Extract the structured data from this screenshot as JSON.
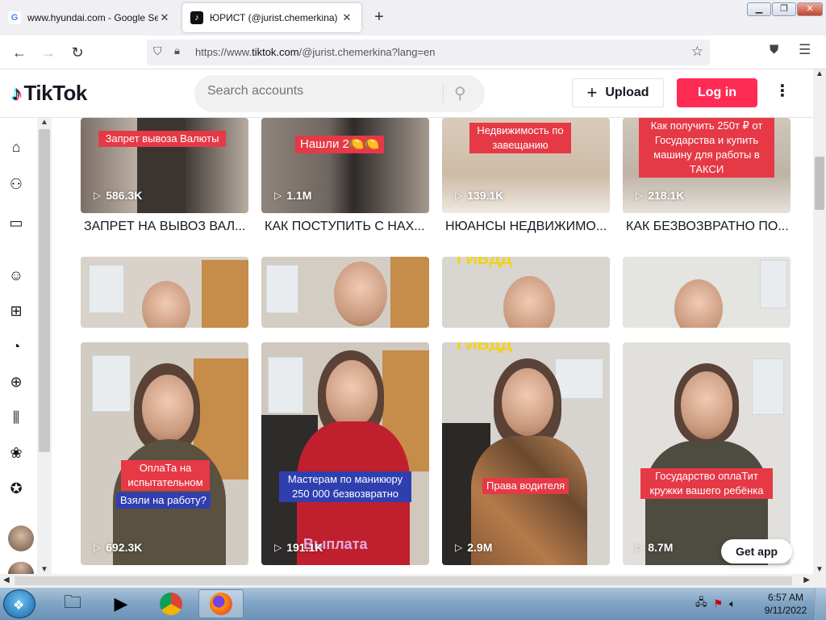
{
  "browser": {
    "tabs": [
      {
        "title": "www.hyundai.com - Google Sea",
        "favicon": "G"
      },
      {
        "title": "ЮРИСТ (@jurist.chemerkina) T",
        "favicon": "♪"
      }
    ],
    "new_tab": "+",
    "url_prefix": "https://www.",
    "url_domain": "tiktok.com",
    "url_suffix": "/@jurist.chemerkina?lang=en"
  },
  "tiktok": {
    "logo": "TikTok",
    "search_placeholder": "Search accounts",
    "upload_label": "Upload",
    "login_label": "Log in"
  },
  "videos": [
    {
      "views": "586.3K",
      "title": "ЗАПРЕТ НА ВЫВОЗ ВАЛ...",
      "caption": "Запрет вывоза Валюты"
    },
    {
      "views": "1.1M",
      "title": "КАК ПОСТУПИТЬ С НАХ...",
      "caption": "Нашли 2🍋🍋"
    },
    {
      "views": "139.1K",
      "title": "НЮАНСЫ НЕДВИЖИМО...",
      "caption": "Недвижимость по завещанию"
    },
    {
      "views": "218.1K",
      "title": "КАК БЕЗВОЗВРАТНО ПО...",
      "caption": "Как получить 250т ₽ от Государства и купить машину для работы в ТАКСИ"
    },
    {
      "views": "692.3K",
      "title": "",
      "caption1": "ОплаТа на испытательном",
      "caption2": "Взяли на работу?"
    },
    {
      "views": "191.1K",
      "title": "",
      "caption": "Мастерам по маникюру 250 000 безвозвратно",
      "overlay": "Выплата"
    },
    {
      "views": "2.9M",
      "title": "",
      "caption": "Права водителя",
      "overlay": "ГИБДД"
    },
    {
      "views": "8.7M",
      "title": "",
      "caption": "Государство оплаТит кружки вашего ребёнка"
    }
  ],
  "row2_overlay": "ГИБДД",
  "get_app": "Get app",
  "clock": {
    "time": "6:57 AM",
    "date": "9/11/2022"
  },
  "colors": {
    "tiktok_red": "#fe2c55",
    "caption_red": "#e63946",
    "caption_blue": "#2f3fb0"
  }
}
